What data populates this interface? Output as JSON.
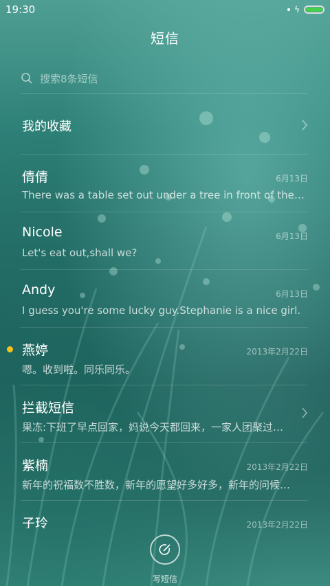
{
  "status_bar": {
    "time": "19:30"
  },
  "header": {
    "title": "短信"
  },
  "search": {
    "placeholder": "搜索8条短信"
  },
  "favorites": {
    "label": "我的收藏"
  },
  "conversations": [
    {
      "name": "倩倩",
      "date": "6月13日",
      "snippet": "There was a table set out under a tree in front of the ho…",
      "unread": false,
      "chevron": false
    },
    {
      "name": "Nicole",
      "date": "6月13日",
      "snippet": "Let's eat out,shall we?",
      "unread": false,
      "chevron": false
    },
    {
      "name": "Andy",
      "date": "6月13日",
      "snippet": "I guess you're some lucky guy.Stephanie is a nice girl.",
      "unread": false,
      "chevron": false
    },
    {
      "name": "燕婷",
      "date": "2013年2月22日",
      "snippet": "嗯。收到啦。同乐同乐。",
      "unread": true,
      "chevron": false
    },
    {
      "name": "拦截短信",
      "date": "",
      "snippet": "果冻:下班了早点回家，妈说今天都回来，一家人团聚过…",
      "unread": false,
      "chevron": true
    },
    {
      "name": "紫楠",
      "date": "2013年2月22日",
      "snippet": "新年的祝福数不胜数，新年的愿望好多好多，新年的问候…",
      "unread": false,
      "chevron": false
    },
    {
      "name": "子玲",
      "date": "2013年2月22日",
      "snippet": "",
      "unread": false,
      "chevron": false
    }
  ],
  "compose": {
    "label": "写短信"
  },
  "colors": {
    "unread_dot": "#f2c21b",
    "battery": "#45d04c"
  }
}
